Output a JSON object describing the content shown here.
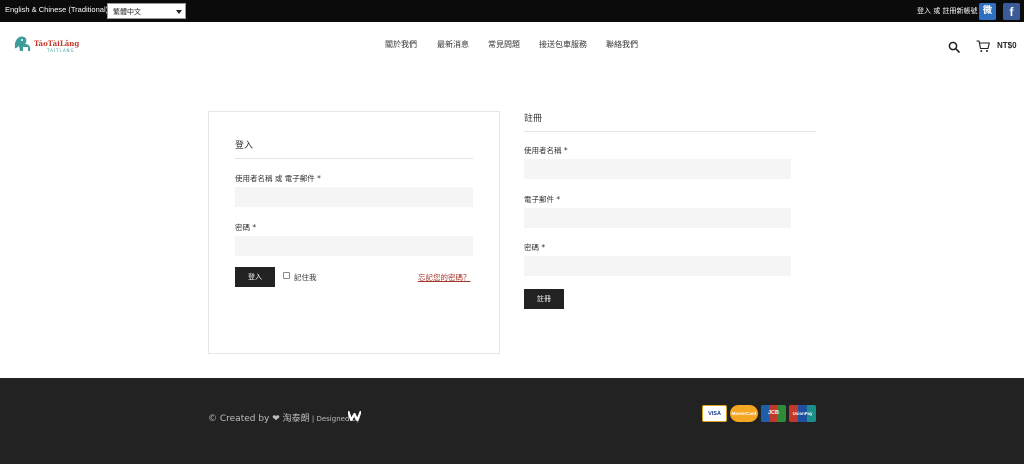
{
  "topbar": {
    "language_label": "English & Chinese (Traditional)",
    "language_select_value": "繁體中文",
    "account_link": "登入 或 註冊新帳號",
    "weibo_glyph": "微",
    "facebook_glyph": "f"
  },
  "header": {
    "logo_text": "TáoTàiLǎng",
    "logo_subtext": "TAITLANG",
    "nav": [
      "關於我們",
      "最新消息",
      "常見問題",
      "接送包車服務",
      "聯絡我們"
    ],
    "cart_total": "NT$0"
  },
  "login": {
    "title": "登入",
    "username_label": "使用者名稱 或 電子郵件 *",
    "password_label": "密碼 *",
    "submit_label": "登入",
    "remember_label": "記住我",
    "forgot_link": "忘記您的密碼？"
  },
  "register": {
    "title": "註冊",
    "username_label": "使用者名稱 *",
    "email_label": "電子郵件 *",
    "password_label": "密碼 *",
    "submit_label": "註冊"
  },
  "footer": {
    "credit_prefix": "© Created by ❤ 淘泰朗",
    "credit_suffix": " | Designed by",
    "payment_cards": [
      "VISA",
      "MasterCard",
      "JCB",
      "UnionPay"
    ]
  },
  "colors": {
    "topbar_bg": "#0b0b0b",
    "footer_bg": "#222222",
    "button_bg": "#222222",
    "link_accent": "#a3362a",
    "logo_teal": "#3e9c9a",
    "logo_red": "#c0392b"
  },
  "icons": {
    "search": "search-icon",
    "cart": "cart-icon",
    "weibo": "weibo-icon",
    "facebook": "facebook-icon"
  }
}
